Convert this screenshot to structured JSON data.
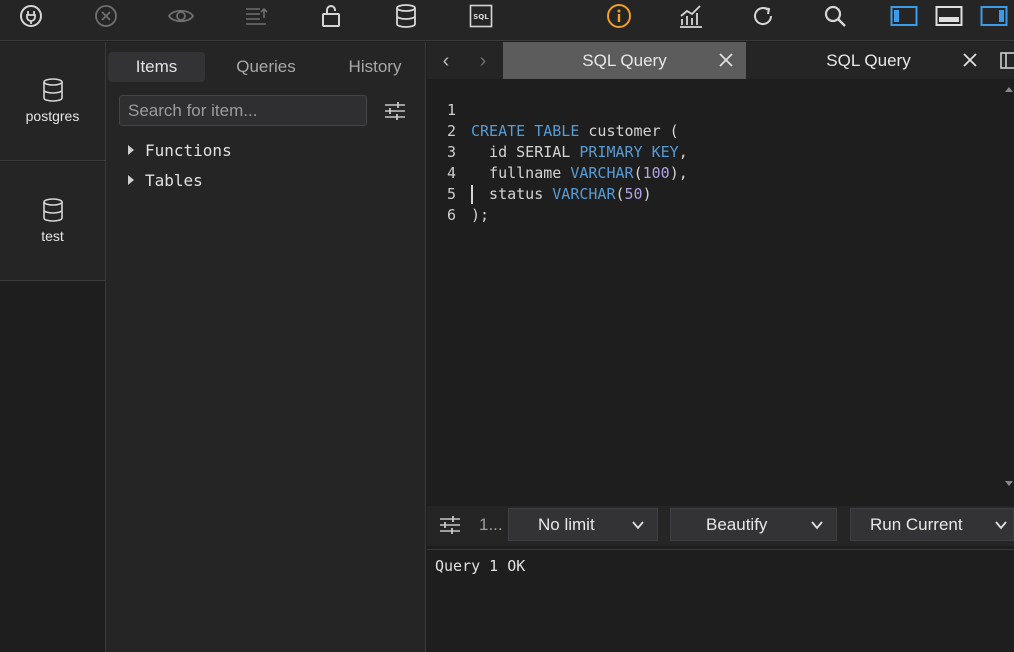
{
  "toolbar": {
    "icons": [
      "connect-icon",
      "disconnect-icon",
      "preview-icon",
      "list-upload-icon",
      "unlock-icon",
      "database-icon",
      "sql-icon",
      "info-icon",
      "chart-icon",
      "refresh-icon",
      "search-icon",
      "layout-left-icon",
      "layout-bottom-icon",
      "layout-right-icon"
    ],
    "sql_icon_text": "SQL",
    "accent_color": "#3b9be8",
    "info_color": "#f0a023"
  },
  "connections": [
    {
      "label": "postgres"
    },
    {
      "label": "test"
    }
  ],
  "items_panel": {
    "tabs": [
      "Items",
      "Queries",
      "History"
    ],
    "active_tab": "Items",
    "search_placeholder": "Search for item...",
    "tree": [
      "Functions",
      "Tables"
    ]
  },
  "editor": {
    "tabs": [
      {
        "label": "SQL Query",
        "active": true
      },
      {
        "label": "SQL Query",
        "active": false
      }
    ],
    "line_numbers": [
      "1",
      "2",
      "3",
      "4",
      "5",
      "6"
    ],
    "code": {
      "l1": {
        "kw1": "CREATE",
        "kw2": "TABLE",
        "rest": " customer ("
      },
      "l2": {
        "a": "  id SERIAL ",
        "kw": "PRIMARY KEY",
        "b": ","
      },
      "l3": {
        "a": "  fullname ",
        "kw": "VARCHAR",
        "p1": "(",
        "num": "100",
        "p2": "),"
      },
      "l4": {
        "a": "  status ",
        "kw": "VARCHAR",
        "p1": "(",
        "num": "50",
        "p2": ")"
      },
      "l5": ");",
      "l6": ""
    }
  },
  "query_bar": {
    "truncated_label": "1...",
    "limit_label": "No limit",
    "beautify_label": "Beautify",
    "run_label": "Run Current"
  },
  "output": {
    "message": "Query 1 OK"
  }
}
